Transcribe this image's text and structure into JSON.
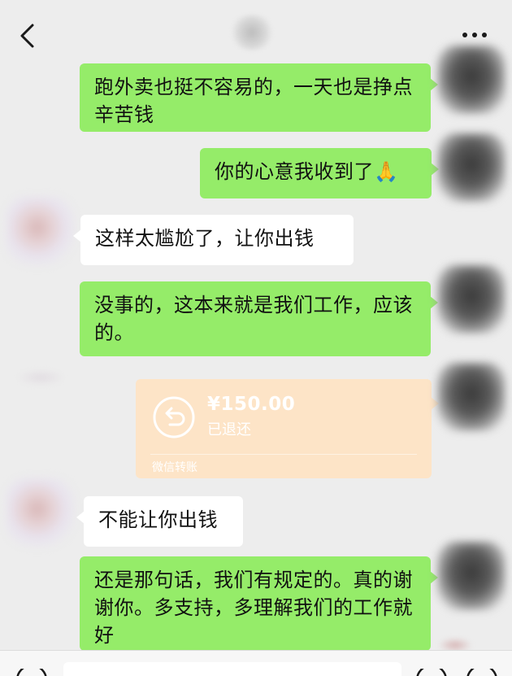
{
  "header": {
    "back_icon": "chevron-left-icon",
    "more_icon": "ellipsis-icon"
  },
  "messages": [
    {
      "side": "out",
      "text": "跑外卖也挺不容易的，一天也是挣点辛苦钱"
    },
    {
      "side": "out",
      "text": "你的心意我收到了🙏"
    },
    {
      "side": "in",
      "text": "这样太尴尬了，让你出钱"
    },
    {
      "side": "out",
      "text": "没事的，这本来就是我们工作，应该的。"
    },
    {
      "side": "out",
      "type": "transfer",
      "amount": "¥150.00",
      "status": "已退还",
      "footer": "微信转账"
    },
    {
      "side": "in",
      "text": "不能让你出钱"
    },
    {
      "side": "out",
      "text": "还是那句话，我们有规定的。真的谢谢你。多支持，多理解我们的工作就好"
    }
  ],
  "colors": {
    "background": "#ededed",
    "outgoing_bubble": "#95ec69",
    "incoming_bubble": "#ffffff",
    "transfer_bubble": "#fde4c7"
  },
  "input_bar": {
    "voice_icon": "voice-icon",
    "emoji_icon": "emoji-icon",
    "plus_icon": "plus-icon"
  }
}
